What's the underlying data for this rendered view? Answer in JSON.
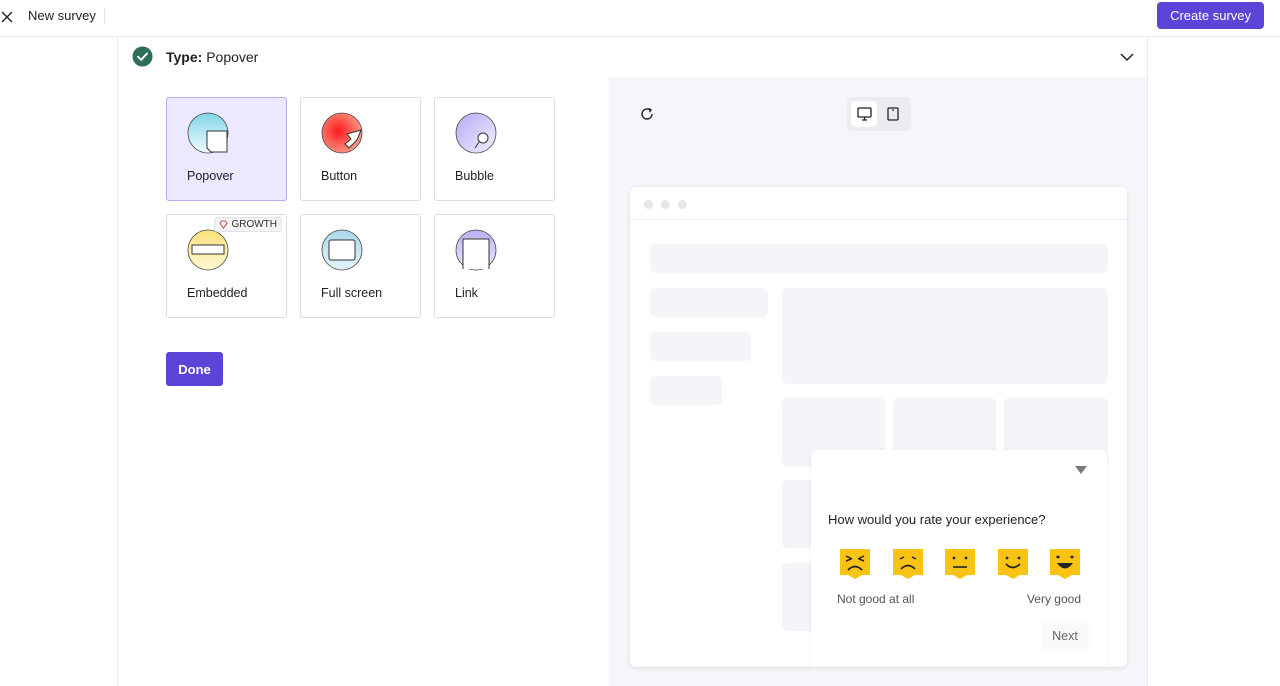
{
  "header": {
    "title": "New survey",
    "create_label": "Create survey"
  },
  "type_section": {
    "prefix": "Type:",
    "value": "Popover",
    "options": [
      {
        "label": "Popover",
        "selected": true
      },
      {
        "label": "Button",
        "selected": false
      },
      {
        "label": "Bubble",
        "selected": false
      },
      {
        "label": "Embedded",
        "selected": false,
        "badge": "GROWTH"
      },
      {
        "label": "Full screen",
        "selected": false
      },
      {
        "label": "Link",
        "selected": false
      }
    ],
    "done_label": "Done"
  },
  "preview": {
    "question": "How would you rate your experience?",
    "low_label": "Not good at all",
    "high_label": "Very good",
    "next_label": "Next",
    "face_color": "#f8c312"
  },
  "colors": {
    "accent": "#5a45d8",
    "check": "#2f6e57"
  }
}
